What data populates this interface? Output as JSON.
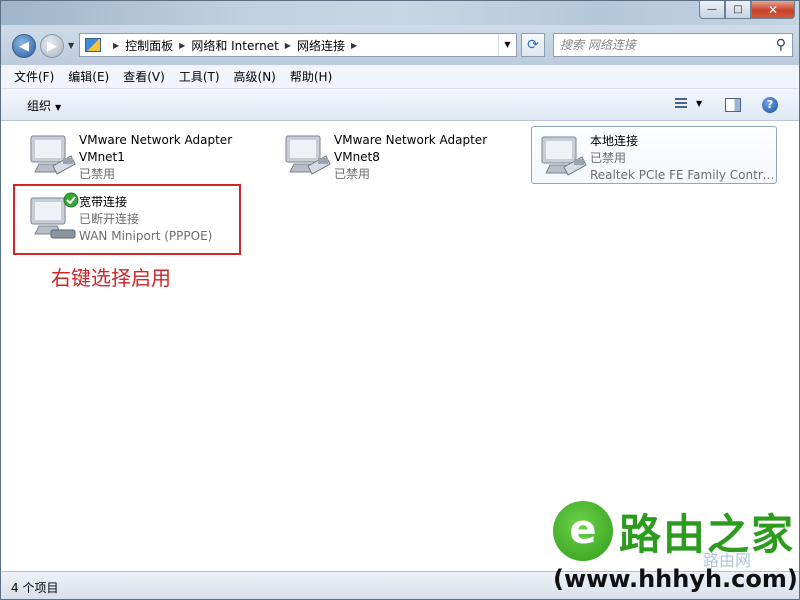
{
  "window": {
    "caption": {
      "minimize": "—",
      "maximize": "□",
      "close": "✕"
    }
  },
  "address": {
    "crumbs": [
      "控制面板",
      "网络和 Internet",
      "网络连接"
    ],
    "search_placeholder": "搜索 网络连接"
  },
  "menu": [
    "文件(F)",
    "编辑(E)",
    "查看(V)",
    "工具(T)",
    "高级(N)",
    "帮助(H)"
  ],
  "toolbar": {
    "organize_label": "组织"
  },
  "connections": [
    {
      "name": "VMware Network Adapter",
      "line2": "VMnet1",
      "status": "已禁用",
      "device": ""
    },
    {
      "name": "VMware Network Adapter",
      "line2": "VMnet8",
      "status": "已禁用",
      "device": ""
    },
    {
      "name": "本地连接",
      "line2": "",
      "status": "已禁用",
      "device": "Realtek PCIe FE Family Controll..."
    },
    {
      "name": "宽带连接",
      "line2": "",
      "status": "已断开连接",
      "device": "WAN Miniport (PPPOE)"
    }
  ],
  "annotation": "右键选择启用",
  "status": {
    "item_count": "4 个项目"
  },
  "watermark": {
    "logo_letter": "e",
    "title": "路由之家",
    "sub": "路由网",
    "url": "(www.hhhyh.com)"
  },
  "colors": {
    "annotation": "#d0262a",
    "watermark_green": "#2d9b1e"
  }
}
